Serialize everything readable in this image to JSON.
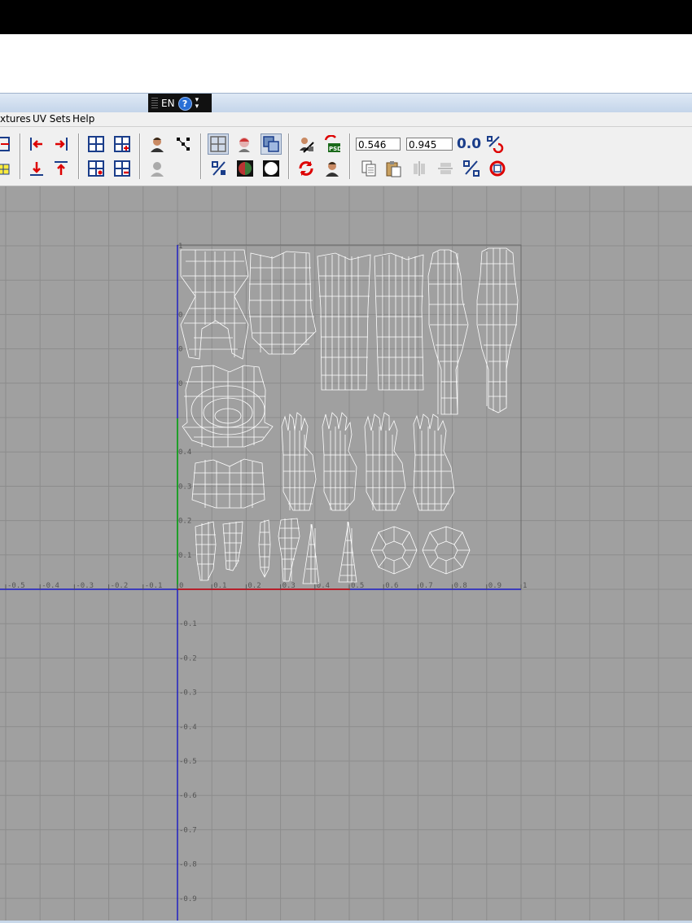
{
  "language_bar": {
    "language": "EN",
    "help_glyph": "?"
  },
  "menu": {
    "items": [
      "xtures",
      "UV Sets",
      "Help"
    ]
  },
  "toolbar": {
    "u_value": "0.546",
    "v_value": "0.945",
    "reset_label": "0.0",
    "psd_badge": "PSD"
  },
  "uv_editor": {
    "x_axis_labels": [
      "-0.5",
      "-0.4",
      "-0.3",
      "-0.2",
      "-0.1",
      "0",
      "0.1",
      "0.2",
      "0.3",
      "0.4",
      "0.5",
      "0.6",
      "0.7",
      "0.8",
      "0.9",
      "1"
    ],
    "y_axis_labels_positive": [
      "1",
      "0",
      "0",
      "0",
      "0.4",
      "0.3",
      "0.2",
      "0.1"
    ],
    "y_axis_labels_negative": [
      "-0.1",
      "-0.2",
      "-0.3",
      "-0.4",
      "-0.5",
      "-0.6",
      "-0.7",
      "-0.8",
      "-0.9"
    ],
    "colors": {
      "background": "#a0a0a0",
      "grid": "#8c8c8c",
      "u_axis": "#0000cc",
      "v_axis": "#0000cc",
      "uv_border": "#6a6a6a",
      "wireframe": "#ffffff",
      "u_positive": "#cc0000",
      "v_positive": "#00aa00"
    }
  }
}
